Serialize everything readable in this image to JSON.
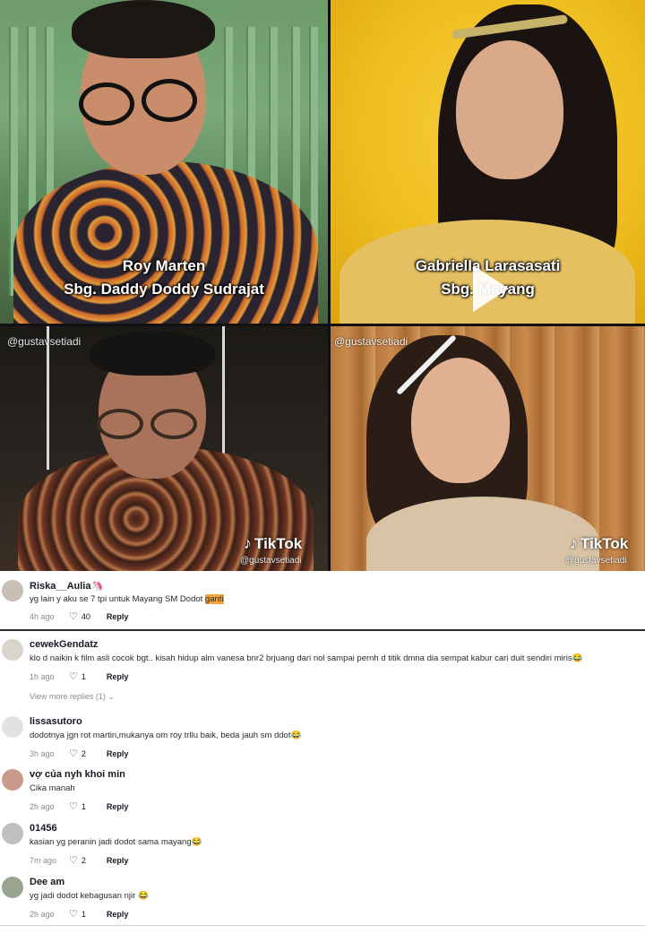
{
  "tiles": [
    {
      "caption_line1": "Roy Marten",
      "caption_line2": "Sbg. Daddy Doddy Sudrajat"
    },
    {
      "caption_line1": "Gabriella Larasasati",
      "caption_line2": "Sbg. Mayang"
    },
    {
      "watermark": "@gustavsetiadi",
      "tiktok": "TikTok",
      "handle": "@gustavsetiadi"
    },
    {
      "watermark": "@gustavsetiadi",
      "tiktok": "TikTok",
      "handle": "@gustavsetiadi"
    }
  ],
  "comments": [
    {
      "user": "Riska__Aulia🦄",
      "text_before": "yg lain y aku se 7 tpi untuk Mayang SM Dodot ",
      "text_highlight": "ganti",
      "time": "4h ago",
      "likes": "40",
      "reply": "Reply"
    },
    {
      "user": "cewekGendatz",
      "text": "klo d naikin k film asli cocok bgt.. kisah hidup alm vanesa bnr2 brjuang dari nol sampai pernh d titik dmna dia sempat kabur cari duit sendiri miris😂",
      "time": "1h ago",
      "likes": "1",
      "reply": "Reply",
      "more": "View more replies (1) ⌄"
    },
    {
      "user": "lissasutoro",
      "text": "dodotnya jgn rot martin,mukanya om roy trllu baik, beda jauh sm ddot😂",
      "time": "3h ago",
      "likes": "2",
      "reply": "Reply"
    },
    {
      "user": "vợ của nyh khoi min",
      "text": "Cika manah",
      "time": "2h ago",
      "likes": "1",
      "reply": "Reply"
    },
    {
      "user": "01456",
      "text": "kasian yg peranin jadi dodot sama mayang😂",
      "time": "7m ago",
      "likes": "2",
      "reply": "Reply"
    },
    {
      "user": "Dee am",
      "text": "yg jadi dodot kebagusan njir 😂",
      "time": "2h ago",
      "likes": "1",
      "reply": "Reply"
    }
  ],
  "icons": {
    "heart": "heart-icon",
    "play": "play-icon",
    "tiktok": "tiktok-logo-icon"
  }
}
